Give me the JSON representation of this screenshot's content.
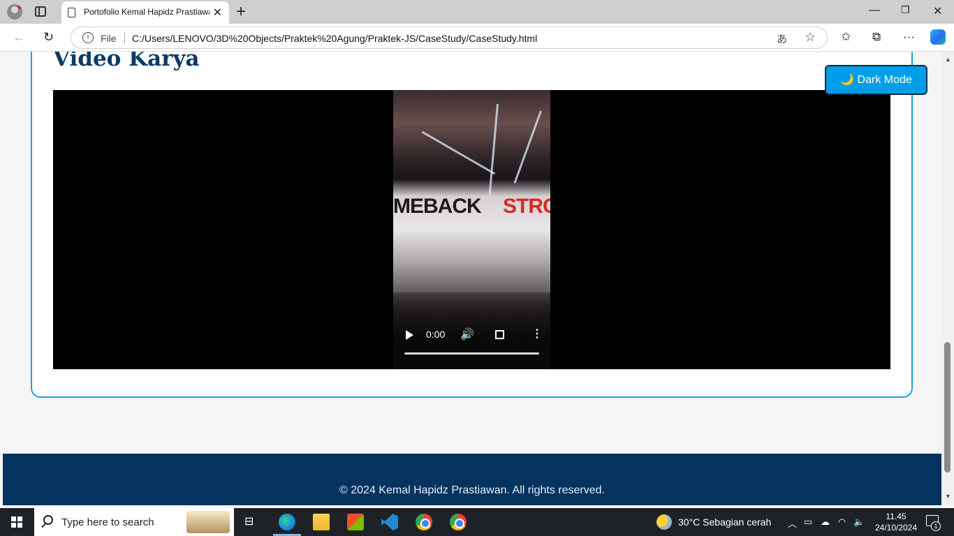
{
  "browser": {
    "tab_title": "Portofolio Kemal Hapidz Prastiawan",
    "address_scheme": "File",
    "url": "C:/Users/LENOVO/3D%20Objects/Praktek%20Agung/Praktek-JS/CaseStudy/CaseStudy.html"
  },
  "page": {
    "section_title": "Video Karya",
    "dark_mode_button": "🌙 Dark Mode",
    "footer_text": "© 2024 Kemal Hapidz Prastiawan. All rights reserved."
  },
  "video": {
    "current_time": "0:00",
    "frame_text_left": "MEBACK",
    "frame_text_right": "STRO",
    "progress": 0
  },
  "taskbar": {
    "search_placeholder": "Type here to search",
    "weather": "30°C  Sebagian cerah",
    "time": "11.45",
    "date": "24/10/2024",
    "notification_count": "1"
  },
  "colors": {
    "accent": "#19a3dc",
    "title": "#0b3a66",
    "dark_button": "#009ee9",
    "footer": "#05335f"
  }
}
